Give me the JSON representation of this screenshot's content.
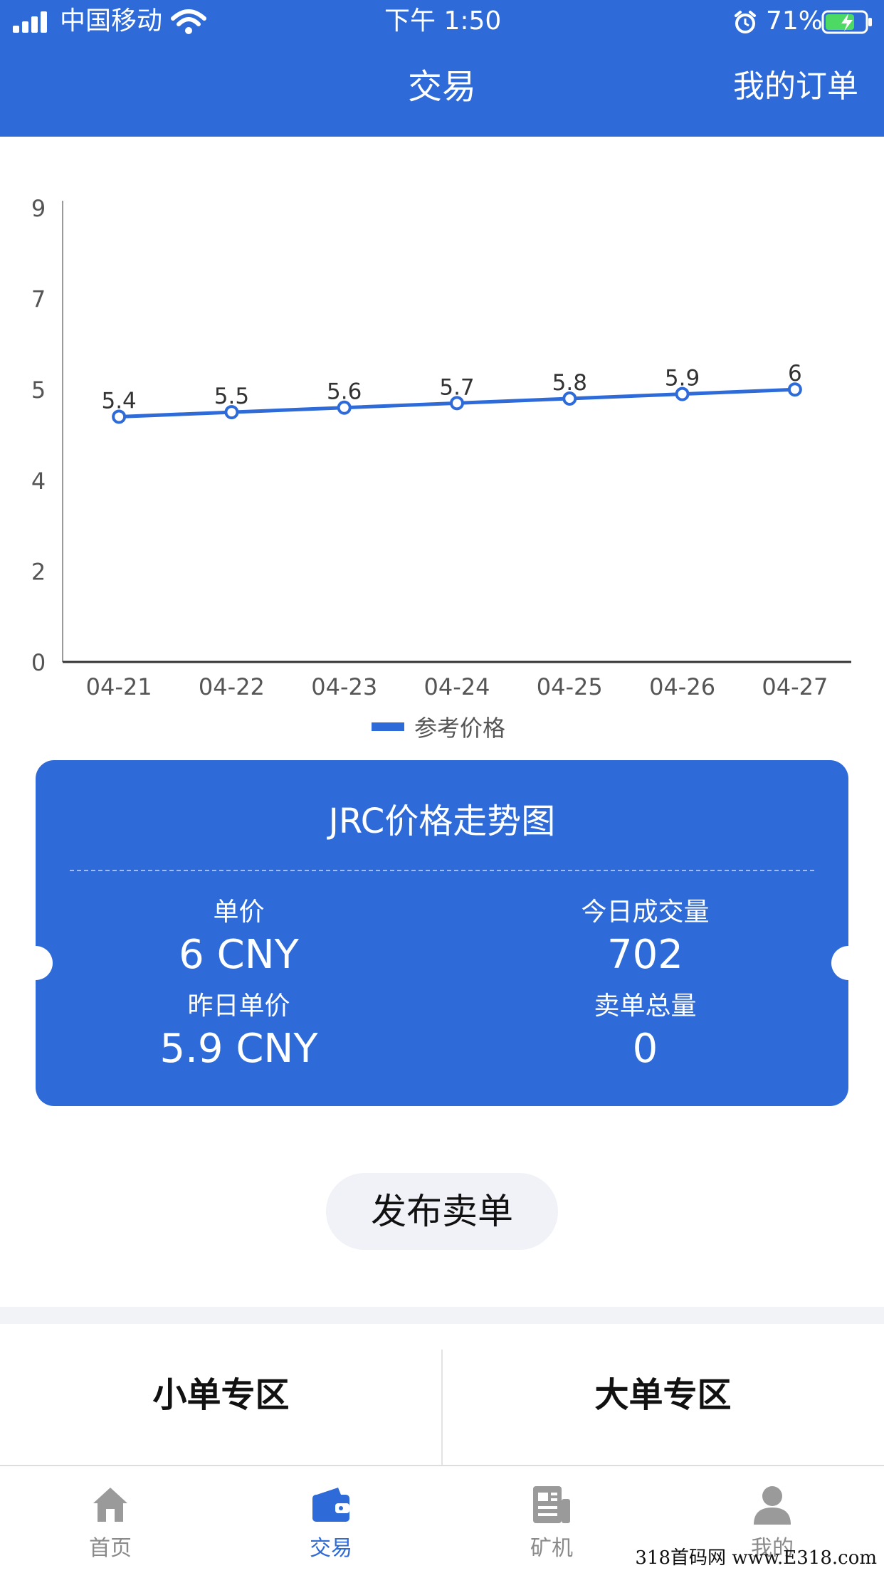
{
  "status_bar": {
    "carrier": "中国移动",
    "time": "下午 1:50",
    "battery": "71%"
  },
  "header": {
    "title": "交易",
    "right_link": "我的订单"
  },
  "chart_data": {
    "type": "line",
    "categories": [
      "04-21",
      "04-22",
      "04-23",
      "04-24",
      "04-25",
      "04-26",
      "04-27"
    ],
    "series": [
      {
        "name": "参考价格",
        "values": [
          5.4,
          5.5,
          5.6,
          5.7,
          5.8,
          5.9,
          6
        ],
        "color": "#2e6bd9"
      }
    ],
    "y_tick_labels": [
      "0",
      "2",
      "4",
      "5",
      "7",
      "9"
    ],
    "ylim": [
      0,
      10
    ],
    "legend_position": "bottom-center",
    "grid": false
  },
  "card": {
    "title": "JRC价格走势图",
    "unit_price_label": "单价",
    "unit_price_value": "6 CNY",
    "today_volume_label": "今日成交量",
    "today_volume_value": "702",
    "yesterday_price_label": "昨日单价",
    "yesterday_price_value": "5.9 CNY",
    "sell_total_label": "卖单总量",
    "sell_total_value": "0"
  },
  "publish_button": "发布卖单",
  "zones": {
    "small": "小单专区",
    "large": "大单专区"
  },
  "tabs": [
    {
      "label": "首页",
      "icon": "home-icon",
      "active": false
    },
    {
      "label": "交易",
      "icon": "wallet-icon",
      "active": true
    },
    {
      "label": "矿机",
      "icon": "miner-icon",
      "active": false
    },
    {
      "label": "我的",
      "icon": "user-icon",
      "active": false
    }
  ],
  "colors": {
    "primary": "#2e6bd9",
    "tab_inactive": "#8a8a8a"
  },
  "watermark": "318首码网 www.E318.com"
}
